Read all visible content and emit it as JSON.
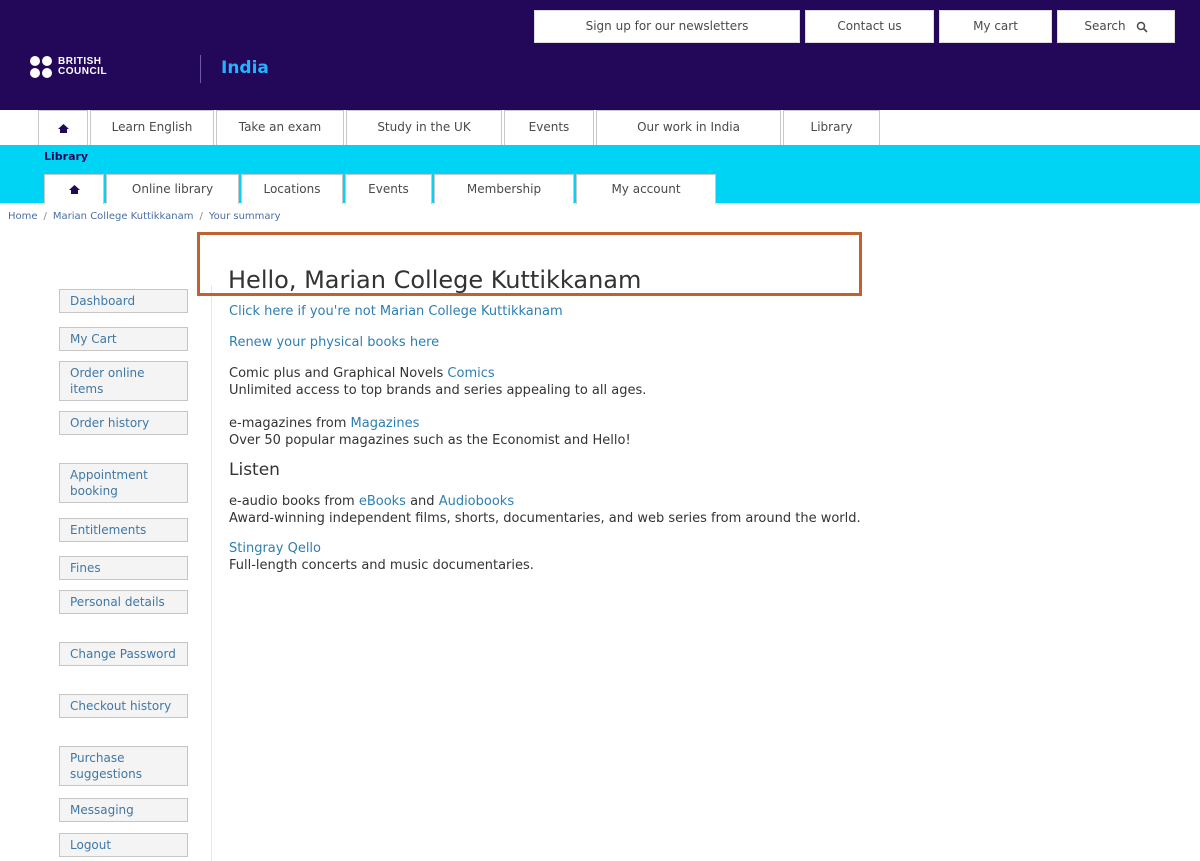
{
  "utility_bar": {
    "newsletters": "Sign up for our newsletters",
    "contact": "Contact us",
    "cart": "My cart",
    "search": "Search"
  },
  "logo": {
    "line1": "BRITISH",
    "line2": "COUNCIL"
  },
  "country": "India",
  "main_nav": [
    "Learn English",
    "Take an exam",
    "Study in the UK",
    "Events",
    "Our work in India",
    "Library"
  ],
  "library": {
    "title": "Library",
    "tabs": [
      "Online library",
      "Locations",
      "Events",
      "Membership",
      "My account"
    ]
  },
  "breadcrumb": [
    "Home",
    "Marian College Kuttikkanam",
    "Your summary"
  ],
  "sidebar": [
    "Dashboard",
    "My Cart",
    "Order online items",
    "Order history",
    "Appointment booking",
    "Entitlements",
    "Fines",
    "Personal details",
    "Change Password",
    "Checkout history",
    "Purchase suggestions",
    "Messaging",
    "Logout"
  ],
  "content": {
    "greeting": "Hello, Marian College Kuttikkanam",
    "not_you_link": "Click here if you're not Marian College Kuttikkanam",
    "renew_link": "Renew your physical books here",
    "comics_text": "Comic plus and Graphical Novels ",
    "comics_link": "Comics",
    "comics_desc": "Unlimited access to top brands and series appealing to all ages.",
    "magazines_text": "e-magazines from ",
    "magazines_link": "Magazines",
    "magazines_desc": "Over 50 popular magazines such as the Economist and Hello!",
    "listen_heading": "Listen",
    "audio_text": "e-audio books from ",
    "ebooks_link": "eBooks",
    "and_text": " and ",
    "audiobooks_link": "Audiobooks",
    "audio_desc": "Award-winning independent films, shorts, documentaries, and web series from around the world.",
    "stingray_link": "Stingray Qello",
    "stingray_desc": "Full-length concerts and music documentaries."
  },
  "colors": {
    "header": "#23085a",
    "library_bar": "#00d4f5",
    "link": "#2e7fb1",
    "highlight_box": "#c0622f"
  },
  "icons": {
    "home": "home-icon",
    "search": "search-icon"
  }
}
